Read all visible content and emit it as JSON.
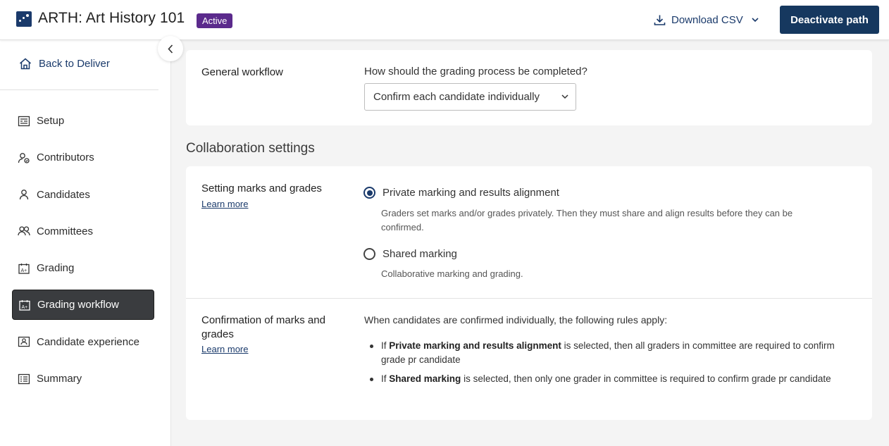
{
  "header": {
    "title": "ARTH: Art History 101",
    "status_badge": "Active",
    "download_label": "Download CSV",
    "deactivate_label": "Deactivate path"
  },
  "sidebar": {
    "back_label": "Back to Deliver",
    "items": [
      {
        "label": "Setup",
        "icon": "setup-icon"
      },
      {
        "label": "Contributors",
        "icon": "contributors-icon"
      },
      {
        "label": "Candidates",
        "icon": "person-icon"
      },
      {
        "label": "Committees",
        "icon": "group-icon"
      },
      {
        "label": "Grading",
        "icon": "grading-icon"
      },
      {
        "label": "Grading workflow",
        "icon": "grading-workflow-icon",
        "active": true
      },
      {
        "label": "Candidate experience",
        "icon": "candidate-experience-icon"
      },
      {
        "label": "Summary",
        "icon": "summary-icon"
      }
    ]
  },
  "general_workflow": {
    "label": "General workflow",
    "question": "How should the grading process be completed?",
    "selected_option": "Confirm each candidate individually"
  },
  "collaboration": {
    "section_title": "Collaboration settings",
    "setting": {
      "label": "Setting marks and grades",
      "learn_more": "Learn more",
      "options": [
        {
          "label": "Private marking and results alignment",
          "selected": true,
          "description": "Graders set marks and/or grades privately. Then they must share and align results before they can be confirmed."
        },
        {
          "label": "Shared marking",
          "selected": false,
          "description": "Collaborative marking and grading."
        }
      ]
    },
    "confirmation": {
      "label": "Confirmation of marks and grades",
      "learn_more": "Learn more",
      "intro": "When candidates are confirmed individually, the following rules apply:",
      "rules": [
        {
          "prefix": "If ",
          "bold": "Private marking and results alignment",
          "suffix": " is selected, then all graders in committee are required to confirm grade pr candidate"
        },
        {
          "prefix": "If ",
          "bold": "Shared marking",
          "suffix": " is selected, then only one grader in committee is required to confirm grade pr candidate"
        }
      ]
    }
  },
  "colors": {
    "brand": "#1a3a6b",
    "badge": "#5b2a8c",
    "active_nav": "#3a3c3f"
  }
}
